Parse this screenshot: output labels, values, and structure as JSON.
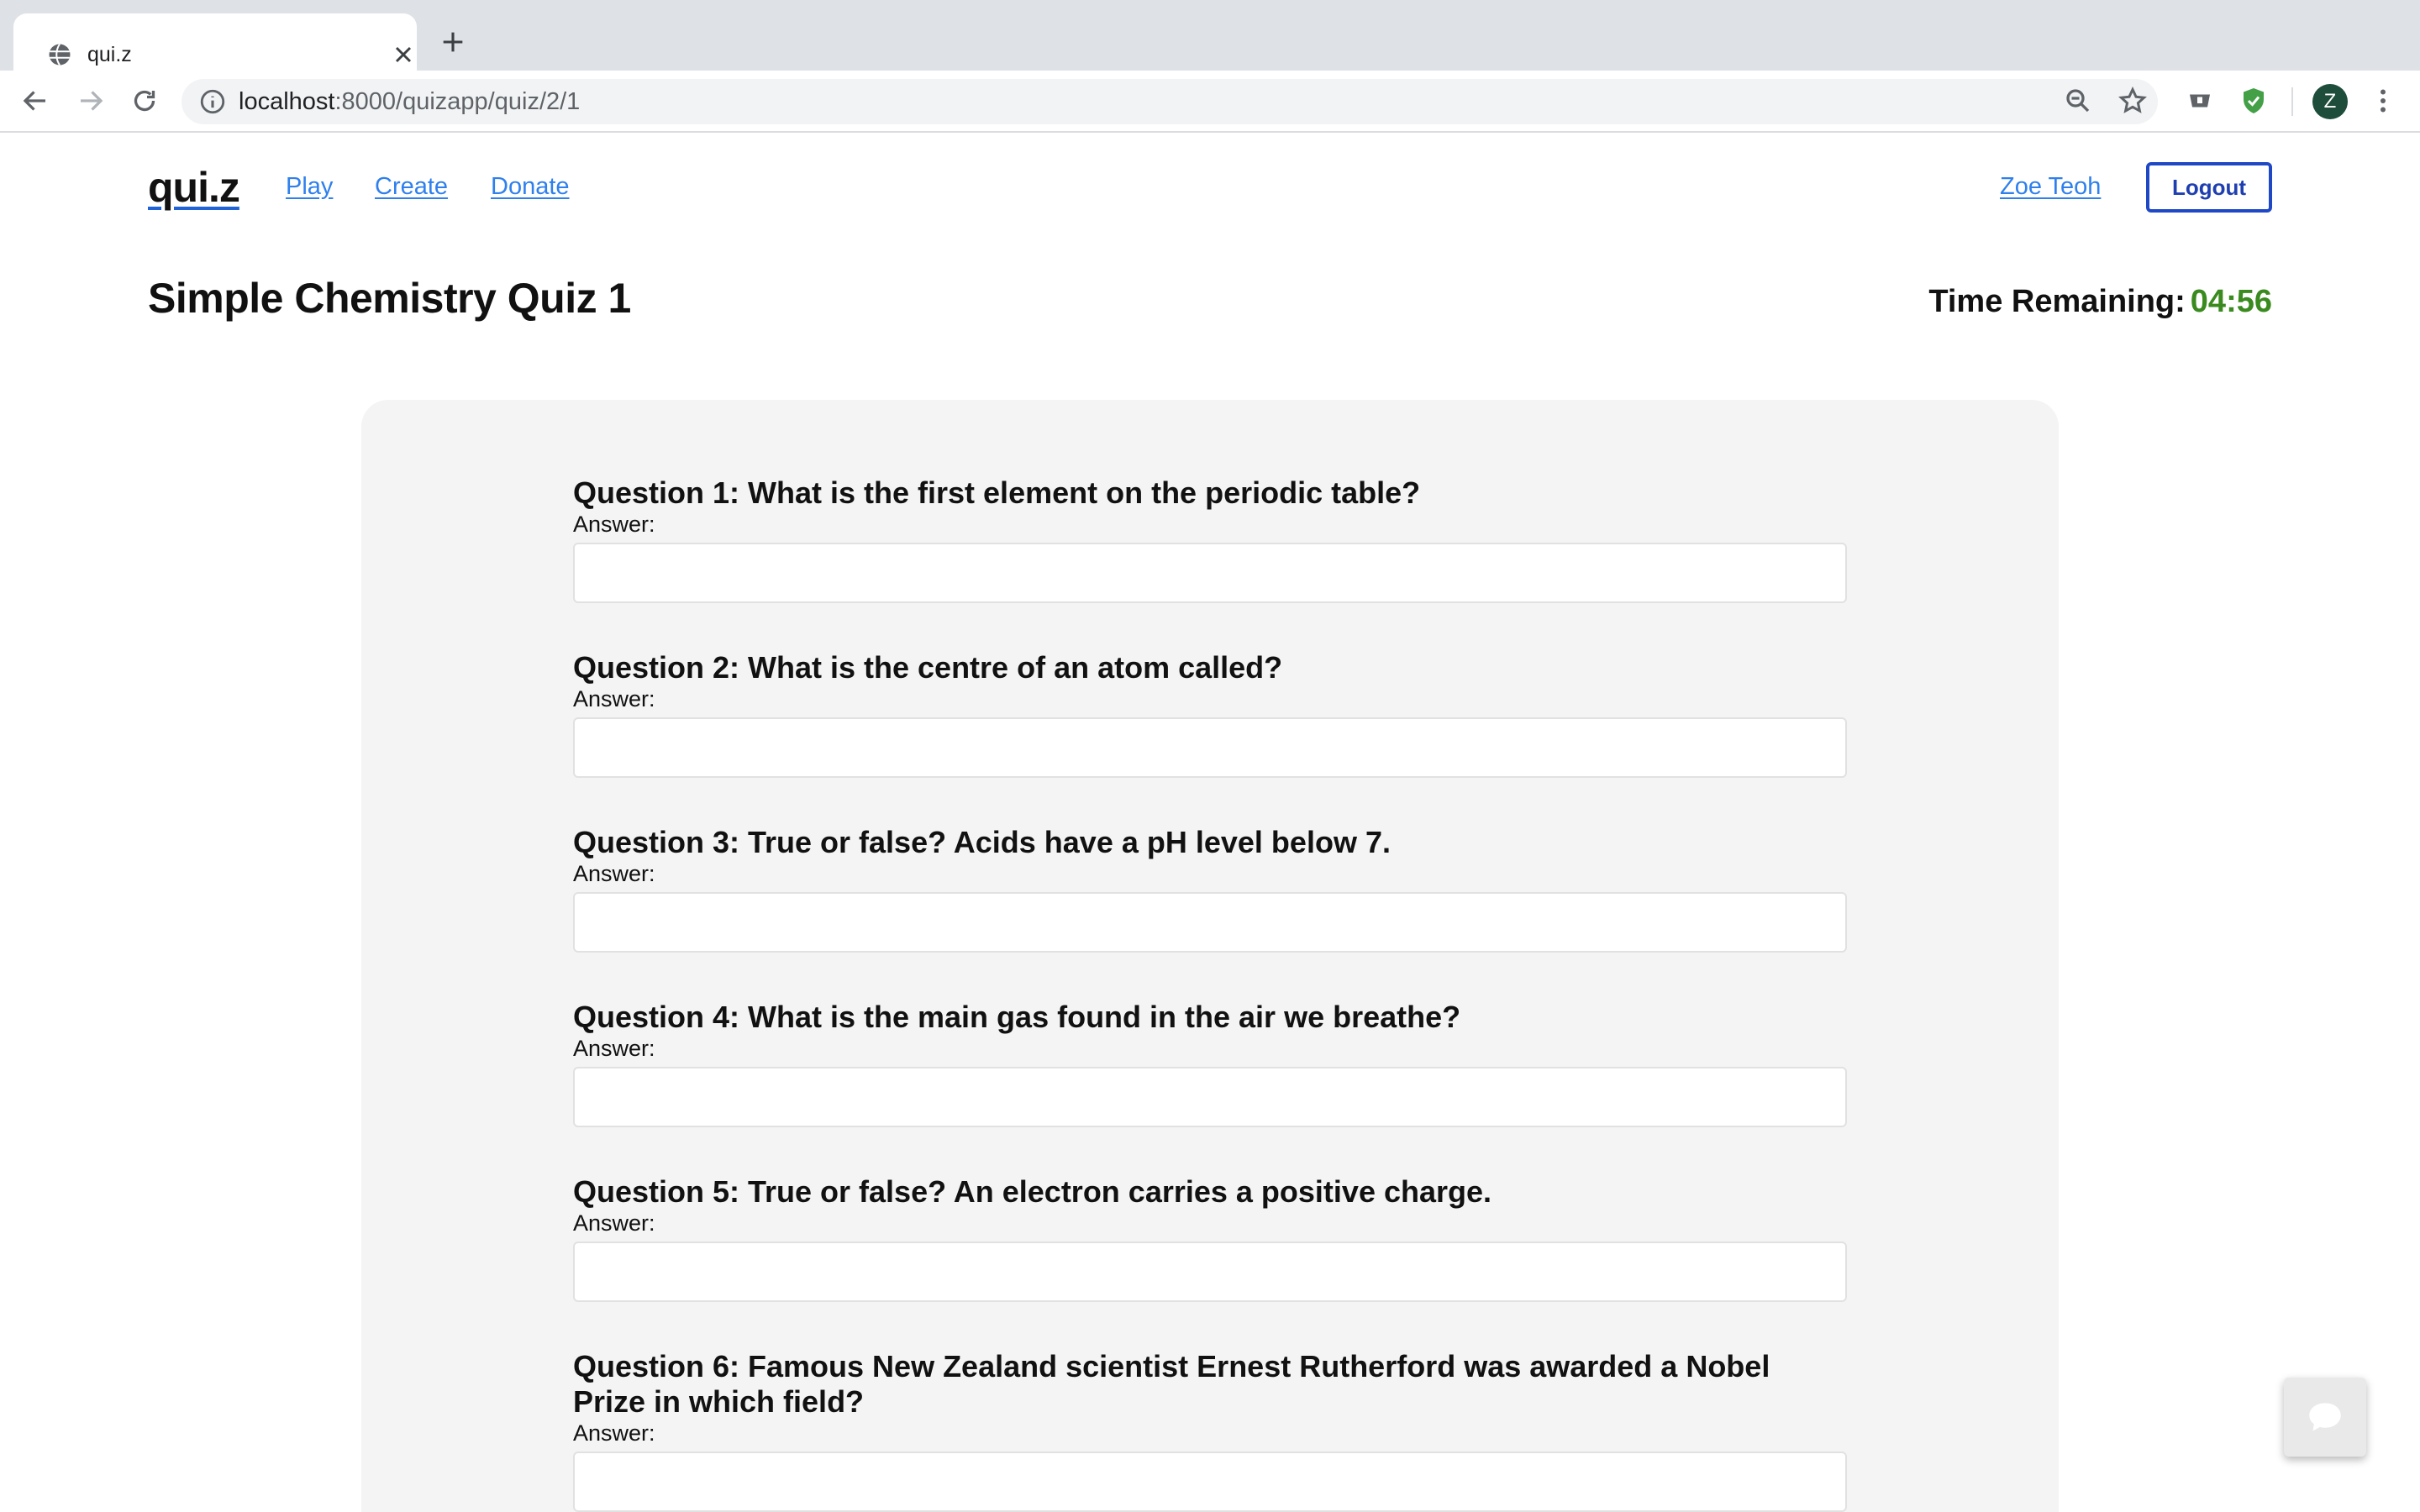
{
  "browser": {
    "tab_title": "qui.z",
    "url_host": "localhost",
    "url_rest": ":8000/quizapp/quiz/2/1",
    "profile_initial": "Z"
  },
  "nav": {
    "logo": "qui.z",
    "links": [
      "Play",
      "Create",
      "Donate"
    ],
    "user": "Zoe Teoh",
    "logout": "Logout"
  },
  "quiz": {
    "title": "Simple Chemistry Quiz 1",
    "timer_label": "Time Remaining:",
    "timer_value": "04:56",
    "answer_label": "Answer:",
    "questions": [
      "Question 1: What is the first element on the periodic table?",
      "Question 2: What is the centre of an atom called?",
      "Question 3: True or false? Acids have a pH level below 7.",
      "Question 4: What is the main gas found in the air we breathe?",
      "Question 5: True or false? An electron carries a positive charge.",
      "Question 6: Famous New Zealand scientist Ernest Rutherford was awarded a Nobel Prize in which field?"
    ]
  },
  "colors": {
    "link": "#2f80ed",
    "timer": "#3a8a1f",
    "logout_border": "#1f48c6",
    "card_bg": "#f4f4f4"
  },
  "icons": [
    "globe-icon",
    "close-icon",
    "plus-icon",
    "back-icon",
    "forward-icon",
    "reload-icon",
    "info-icon",
    "zoom-icon",
    "star-icon",
    "extension-icon",
    "shield-icon",
    "menu-icon",
    "chat-icon"
  ]
}
